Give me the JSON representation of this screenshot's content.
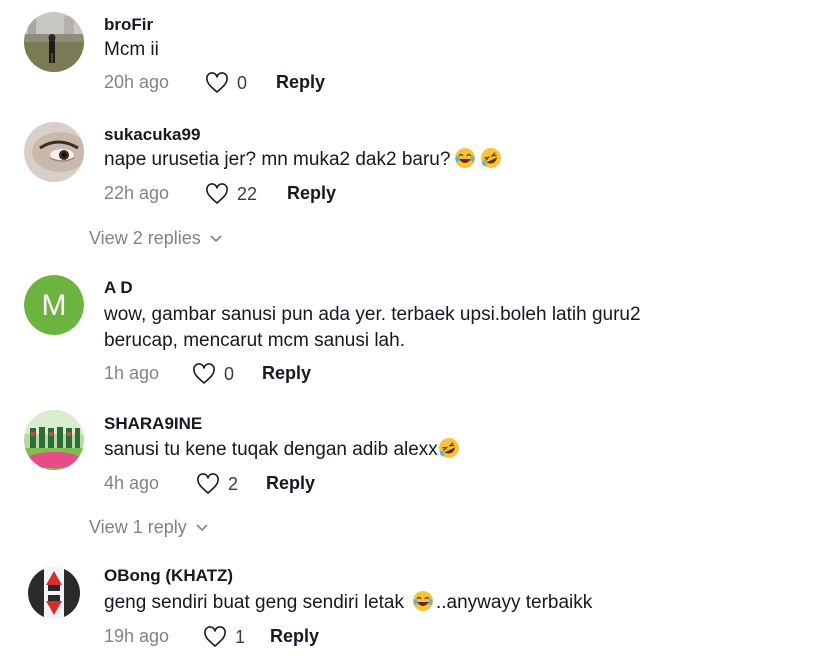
{
  "comments": [
    {
      "username": "broFir",
      "text": "Mcm ii",
      "time": "20h ago",
      "likes": "0",
      "reply": "Reply",
      "avatar": "photo-person-field"
    },
    {
      "username": "sukacuka99",
      "text": "nape urusetia jer? mn muka2 dak2 baru?",
      "time": "22h ago",
      "likes": "22",
      "reply": "Reply",
      "avatar": "photo-eye-closeup",
      "emoji": [
        "tears-of-joy-emoji",
        "rolling-laughing-emoji"
      ]
    },
    {
      "username": "A D",
      "text": "wow, gambar sanusi pun ada yer. terbaek upsi.boleh latih guru2 berucap, mencarut mcm sanusi lah.",
      "time": "1h ago",
      "likes": "0",
      "reply": "Reply",
      "avatar_letter": "M",
      "avatar_color": "#6db33f"
    },
    {
      "username": "SHARA9INE",
      "text": "sanusi tu kene tuqak dengan adib alexx",
      "time": "4h ago",
      "likes": "2",
      "reply": "Reply",
      "avatar": "photo-group-green",
      "emoji": [
        "rolling-laughing-emoji"
      ]
    },
    {
      "username": "OBong (KHATZ)",
      "text": "geng sendiri buat geng sendiri letak",
      "text_after": "..anywayy terbaikk",
      "time": "19h ago",
      "likes": "1",
      "reply": "Reply",
      "avatar": "logo-red-arrows",
      "emoji": [
        "tears-of-joy-emoji"
      ]
    }
  ],
  "view_replies": [
    {
      "label": "View 2 replies"
    },
    {
      "label": "View 1 reply"
    }
  ],
  "colors": {
    "accent_green": "#6db33f",
    "muted_text": "#8a8b91",
    "text": "#161823"
  }
}
